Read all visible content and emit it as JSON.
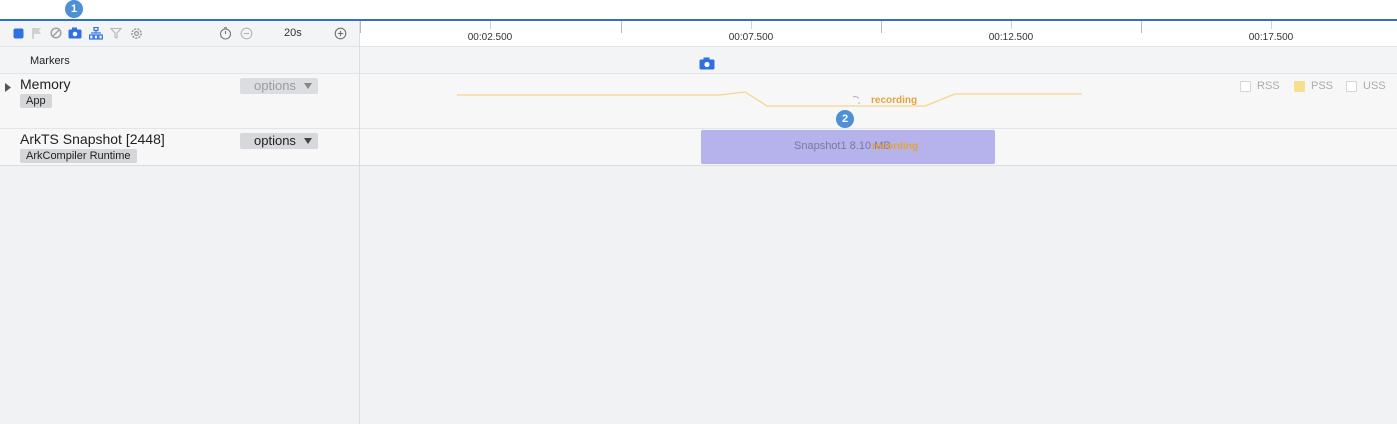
{
  "annotations": {
    "badge1": "1",
    "badge2": "2"
  },
  "toolbar": {
    "icons": [
      "stop-icon",
      "flag-icon",
      "ban-icon",
      "camera-icon",
      "tree-icon",
      "filter-icon",
      "gear-icon",
      "timer-icon",
      "zoom-out-icon",
      "zoom-in-icon"
    ],
    "duration": "20s"
  },
  "timeline": {
    "labels": [
      "00:02.500",
      "00:07.500",
      "00:12.500",
      "00:17.500"
    ]
  },
  "markers": {
    "label": "Markers"
  },
  "memory": {
    "title": "Memory",
    "tag": "App",
    "options": "options",
    "recording": "recording",
    "legend": [
      {
        "label": "RSS",
        "checked": false
      },
      {
        "label": "PSS",
        "checked": true
      },
      {
        "label": "USS",
        "checked": false
      }
    ]
  },
  "ark": {
    "title": "ArkTS Snapshot [2448]",
    "tag": "ArkCompiler Runtime",
    "options": "options",
    "snapshot_label": "Snapshot1 8.10 MB",
    "recording": "recording"
  },
  "colors": {
    "accent": "#2f6fcf",
    "snapshot_bar": "#b5b2ec",
    "pss_line": "#f6d58a",
    "recording": "#e4a23d",
    "badge": "#4f8fd3"
  }
}
